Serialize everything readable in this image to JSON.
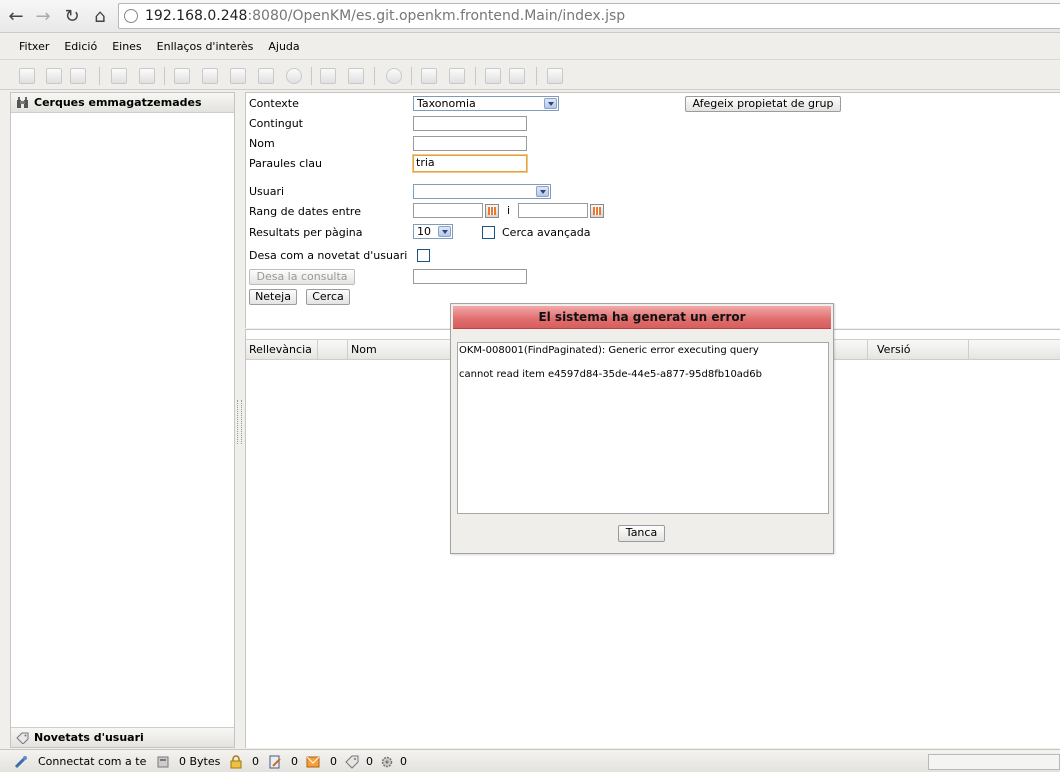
{
  "browser": {
    "url_host": "192.168.0.248",
    "url_rest": ":8080/OpenKM/es.git.openkm.frontend.Main/index.jsp"
  },
  "menu": {
    "items": [
      "Fitxer",
      "Edició",
      "Eines",
      "Enllaços d'interès",
      "Ajuda"
    ]
  },
  "left_panel": {
    "saved_searches_title": "Cerques emmagatzemades",
    "user_news_title": "Novetats d'usuari"
  },
  "search_form": {
    "context_label": "Contexte",
    "context_value": "Taxonomia",
    "add_group_property_button": "Afegeix propietat de grup",
    "content_label": "Contingut",
    "content_value": "",
    "name_label": "Nom",
    "name_value": "",
    "keywords_label": "Paraules clau",
    "keywords_value": "tria",
    "user_label": "Usuari",
    "user_value": "",
    "date_range_label": "Rang de dates entre",
    "date_and": "i",
    "results_per_page_label": "Resultats per pàgina",
    "results_per_page_value": "10",
    "advanced_search_label": "Cerca avançada",
    "save_as_news_label": "Desa com a novetat d'usuari",
    "save_query_button": "Desa la consulta",
    "query_name_value": "",
    "clear_button": "Neteja",
    "search_button": "Cerca"
  },
  "results": {
    "columns": [
      "Rellevància",
      "Nom",
      "Versió"
    ]
  },
  "dialog": {
    "title": "El sistema ha generat un error",
    "line1": "OKM-008001(FindPaginated): Generic error executing query",
    "line2": "cannot read item e4597d84-35de-44e5-a877-95d8fb10ad6b",
    "close_button": "Tanca"
  },
  "status_bar": {
    "connected_text": "Connectat com a te",
    "size_text": "0 Bytes",
    "locked_count": "0",
    "checkout_count": "0",
    "mail_count": "0",
    "subscription_count": "0",
    "workflow_count": "0"
  }
}
